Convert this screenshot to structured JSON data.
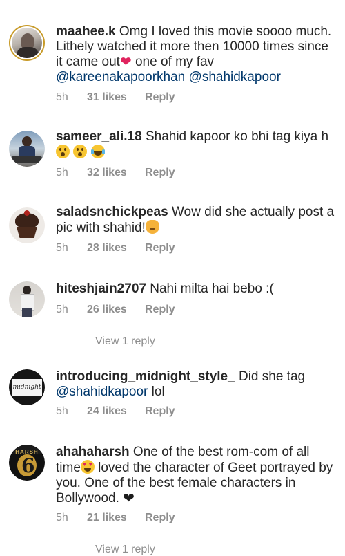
{
  "comments": [
    {
      "username": "maahee.k",
      "text_1": " Omg I loved this movie soooo much. Lithely watched it more then 10000 times since it came out",
      "text_2": " one of my fav ",
      "mention_1": "@kareenakapoorkhan",
      "mention_2": "@shahidkapoor",
      "time": "5h",
      "likes": "31 likes",
      "reply": "Reply"
    },
    {
      "username": "sameer_ali.18",
      "text_1": " Shahid kapoor ko bhi tag kiya h",
      "time": "5h",
      "likes": "32 likes",
      "reply": "Reply"
    },
    {
      "username": "saladsnchickpeas",
      "text_1": " Wow did she actually post a pic with shahid!",
      "time": "5h",
      "likes": "28 likes",
      "reply": "Reply"
    },
    {
      "username": "hiteshjain2707",
      "text_1": " Nahi milta hai bebo :(",
      "time": "5h",
      "likes": "26 likes",
      "reply": "Reply",
      "view_replies": "View 1 reply"
    },
    {
      "username": "introducing_midnight_style_",
      "text_1": " Did she tag ",
      "mention_1": "@shahidkapoor",
      "text_2": " lol",
      "avatar_text": "midnight",
      "time": "5h",
      "likes": "24 likes",
      "reply": "Reply"
    },
    {
      "username": "ahahaharsh",
      "text_1": " One of the best rom-com of all time",
      "text_2": " loved the character of Geet portrayed by you. One of the best female characters in Bollywood. ",
      "avatar_text": "HARSH",
      "avatar_number": "6",
      "time": "5h",
      "likes": "21 likes",
      "reply": "Reply",
      "view_replies": "View 1 reply"
    }
  ],
  "colors": {
    "text": "#262626",
    "mention": "#00376b",
    "meta": "#8e8e8e",
    "heart": "#e0245e"
  },
  "icons": [
    "red-heart-emoji",
    "astonished-emoji",
    "joy-emoji",
    "cat-emoji",
    "heart-eyes-emoji",
    "black-heart-emoji"
  ]
}
